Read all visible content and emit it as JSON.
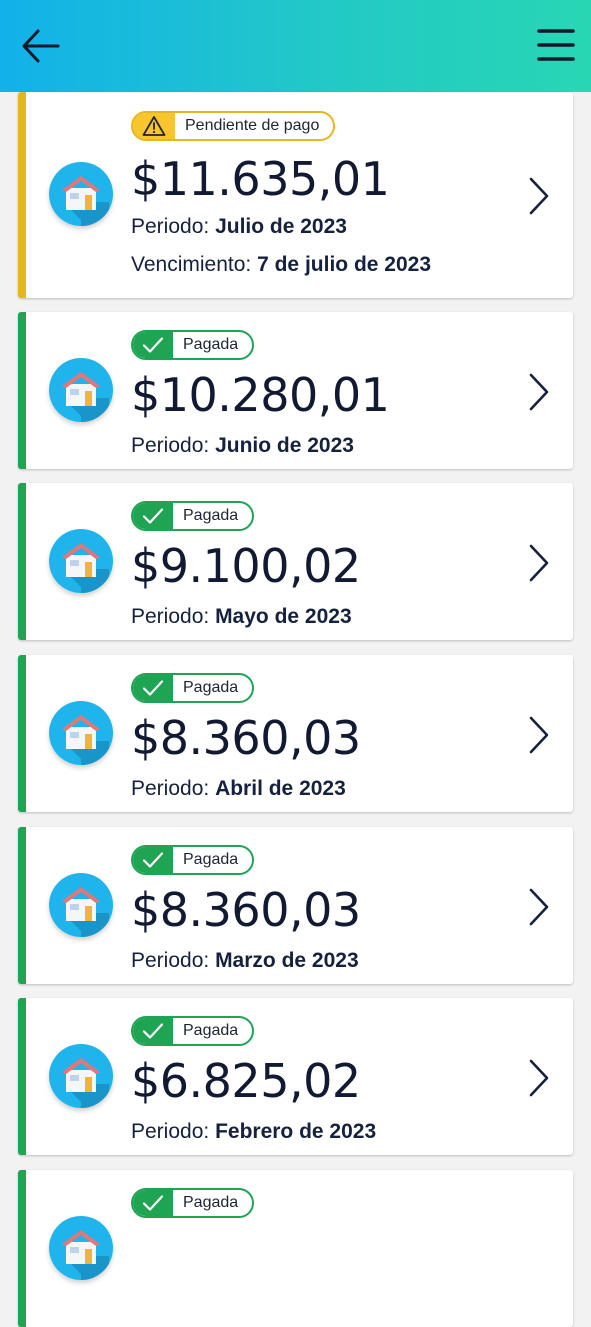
{
  "header": {
    "back_icon": "arrow-left-icon",
    "menu_icon": "hamburger-menu-icon"
  },
  "colors": {
    "pending": "#e9b51e",
    "paid": "#1ea453",
    "text": "#16213e",
    "header_start": "#12b1ea",
    "header_end": "#28d6b4"
  },
  "bills": [
    {
      "status": "pending",
      "badge": "Pendiente de pago",
      "amount": "$11.635,01",
      "period_label": "Periodo:",
      "period": "Julio de 2023",
      "due_label": "Vencimiento:",
      "due": "7 de julio de 2023"
    },
    {
      "status": "paid",
      "badge": "Pagada",
      "amount": "$10.280,01",
      "period_label": "Periodo:",
      "period": "Junio de 2023"
    },
    {
      "status": "paid",
      "badge": "Pagada",
      "amount": "$9.100,02",
      "period_label": "Periodo:",
      "period": "Mayo de 2023"
    },
    {
      "status": "paid",
      "badge": "Pagada",
      "amount": "$8.360,03",
      "period_label": "Periodo:",
      "period": "Abril de 2023"
    },
    {
      "status": "paid",
      "badge": "Pagada",
      "amount": "$8.360,03",
      "period_label": "Periodo:",
      "period": "Marzo de 2023"
    },
    {
      "status": "paid",
      "badge": "Pagada",
      "amount": "$6.825,02",
      "period_label": "Periodo:",
      "period": "Febrero de 2023"
    },
    {
      "status": "paid",
      "badge": "Pagada"
    }
  ]
}
